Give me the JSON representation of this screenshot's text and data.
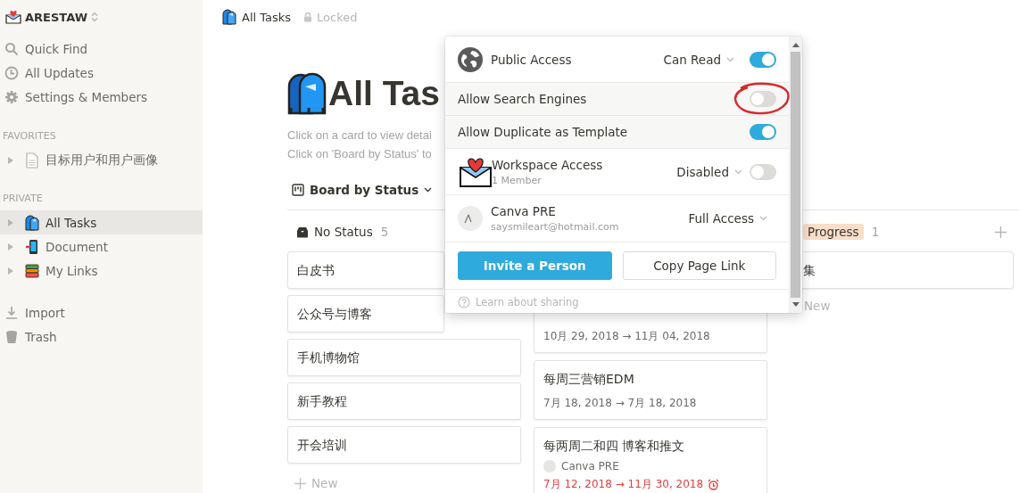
{
  "workspace": {
    "name": "ARESTAW"
  },
  "sidebar": {
    "nav": [
      {
        "kind": "search",
        "label": "Quick Find"
      },
      {
        "kind": "updates",
        "label": "All Updates"
      },
      {
        "kind": "settings",
        "label": "Settings & Members"
      }
    ],
    "sections": [
      {
        "heading": "FAVORITES",
        "pages": [
          {
            "kind": "doc",
            "label": "目标用户和用户画像",
            "selected": false
          }
        ]
      },
      {
        "heading": "PRIVATE",
        "pages": [
          {
            "kind": "mailbox",
            "label": "All Tasks",
            "selected": true
          },
          {
            "kind": "phone",
            "label": "Document",
            "selected": false
          },
          {
            "kind": "books",
            "label": "My Links",
            "selected": false
          }
        ]
      }
    ],
    "footer": [
      {
        "kind": "import",
        "label": "Import"
      },
      {
        "kind": "trash",
        "label": "Trash"
      }
    ]
  },
  "breadcrumb": {
    "page": "All Tasks",
    "lock_label": "Locked"
  },
  "page": {
    "title": "All Tas",
    "description": [
      "Click on a card to view detai",
      "Click on 'Board by Status' to"
    ],
    "view": "Board by Status"
  },
  "board": {
    "columns": [
      {
        "kind": "plain",
        "name": "No Status",
        "count": "5",
        "cards": [
          {
            "title": "白皮书"
          },
          {
            "title": "公众号与博客"
          },
          {
            "title": "手机博物馆"
          },
          {
            "title": "新手教程"
          },
          {
            "title": "开会培训"
          }
        ],
        "new_label": "New"
      },
      {
        "kind": "hidden",
        "cards": [
          {
            "date": "10月 29, 2018 → 11月 04, 2018",
            "covered": true
          },
          {
            "title": "每周三营销EDM",
            "date": "7月 18, 2018 → 7月 18, 2018"
          },
          {
            "title": "每两周二和四 博客和推文",
            "person": "Canva PRE",
            "date": "7月 12, 2018 → 11月 30, 2018",
            "overdue": true
          }
        ]
      },
      {
        "kind": "tag",
        "name": "Progress",
        "count": "1",
        "cards": [
          {
            "title": "集"
          }
        ],
        "new_label": "New"
      }
    ]
  },
  "share_popup": {
    "rows": [
      {
        "kind": "public",
        "label": "Public Access",
        "permission": "Can Read",
        "on": true
      },
      {
        "kind": "option",
        "label": "Allow Search Engines",
        "on": false,
        "annotated": true
      },
      {
        "kind": "option",
        "label": "Allow Duplicate as Template",
        "on": true
      },
      {
        "kind": "workspace",
        "label": "Workspace Access",
        "sublabel": "1 Member",
        "permission": "Disabled",
        "on": false
      },
      {
        "kind": "person",
        "label": "Canva PRE",
        "sublabel": "saysmileart@hotmail.com",
        "permission": "Full Access"
      }
    ],
    "buttons": [
      {
        "kind": "primary",
        "label": "Invite a Person"
      },
      {
        "kind": "secondary",
        "label": "Copy Page Link"
      }
    ],
    "help": "Learn about sharing"
  }
}
